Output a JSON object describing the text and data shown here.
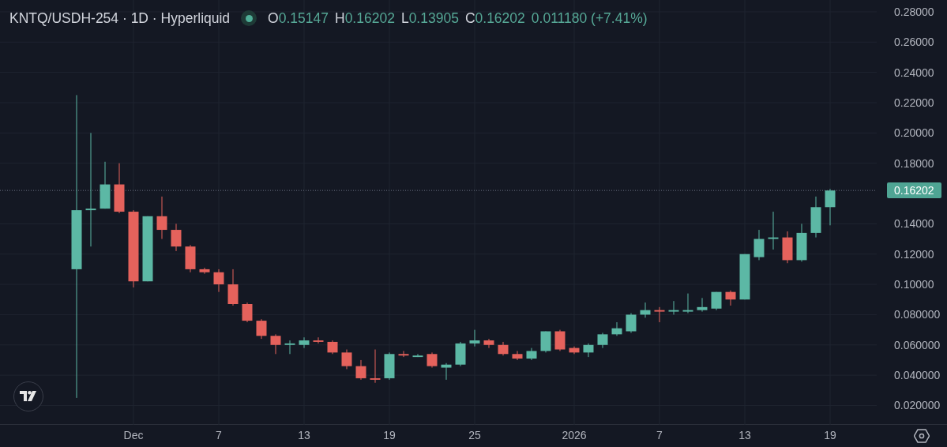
{
  "legend": {
    "symbol": "KNTQ/USDH-254 · 1D · Hyperliquid",
    "ohlc": [
      {
        "key": "O",
        "value": "0.15147"
      },
      {
        "key": "H",
        "value": "0.16202"
      },
      {
        "key": "L",
        "value": "0.13905"
      },
      {
        "key": "C",
        "value": "0.16202"
      }
    ],
    "change": "0.011180 (+7.41%)"
  },
  "chart_data": {
    "type": "candlestick",
    "grid": true,
    "categories": [
      null,
      null,
      null,
      null,
      "Dec",
      null,
      null,
      null,
      null,
      null,
      "7",
      null,
      null,
      null,
      null,
      null,
      "13",
      null,
      null,
      null,
      null,
      null,
      "19",
      null,
      null,
      null,
      null,
      null,
      "25",
      null,
      null,
      null,
      null,
      null,
      null,
      "2026",
      null,
      null,
      null,
      null,
      null,
      "7",
      null,
      null,
      null,
      null,
      null,
      "13",
      null,
      null,
      null,
      null,
      null,
      "19"
    ],
    "ohlc": [
      [
        0.11,
        0.225,
        0.025,
        0.149
      ],
      [
        0.149,
        0.2,
        0.125,
        0.15
      ],
      [
        0.15,
        0.181,
        0.15,
        0.166
      ],
      [
        0.166,
        0.18,
        0.147,
        0.148
      ],
      [
        0.148,
        0.149,
        0.098,
        0.102
      ],
      [
        0.102,
        0.145,
        0.102,
        0.145
      ],
      [
        0.145,
        0.158,
        0.13,
        0.136
      ],
      [
        0.136,
        0.14,
        0.122,
        0.125
      ],
      [
        0.125,
        0.126,
        0.108,
        0.11
      ],
      [
        0.11,
        0.111,
        0.107,
        0.108
      ],
      [
        0.108,
        0.11,
        0.095,
        0.1
      ],
      [
        0.1,
        0.11,
        0.086,
        0.087
      ],
      [
        0.087,
        0.088,
        0.075,
        0.076
      ],
      [
        0.076,
        0.077,
        0.064,
        0.066
      ],
      [
        0.066,
        0.067,
        0.054,
        0.06
      ],
      [
        0.06,
        0.063,
        0.054,
        0.061
      ],
      [
        0.06,
        0.065,
        0.058,
        0.063
      ],
      [
        0.063,
        0.065,
        0.061,
        0.062
      ],
      [
        0.062,
        0.063,
        0.054,
        0.055
      ],
      [
        0.055,
        0.057,
        0.044,
        0.046
      ],
      [
        0.046,
        0.05,
        0.037,
        0.038
      ],
      [
        0.038,
        0.057,
        0.035,
        0.037
      ],
      [
        0.038,
        0.055,
        0.037,
        0.054
      ],
      [
        0.054,
        0.056,
        0.052,
        0.053
      ],
      [
        0.052,
        0.054,
        0.052,
        0.053
      ],
      [
        0.054,
        0.055,
        0.045,
        0.046
      ],
      [
        0.045,
        0.048,
        0.037,
        0.047
      ],
      [
        0.047,
        0.062,
        0.046,
        0.061
      ],
      [
        0.061,
        0.07,
        0.059,
        0.063
      ],
      [
        0.063,
        0.064,
        0.058,
        0.06
      ],
      [
        0.06,
        0.062,
        0.053,
        0.054
      ],
      [
        0.054,
        0.056,
        0.05,
        0.051
      ],
      [
        0.051,
        0.058,
        0.05,
        0.056
      ],
      [
        0.056,
        0.069,
        0.055,
        0.069
      ],
      [
        0.069,
        0.07,
        0.056,
        0.057
      ],
      [
        0.058,
        0.059,
        0.054,
        0.055
      ],
      [
        0.055,
        0.061,
        0.052,
        0.06
      ],
      [
        0.06,
        0.068,
        0.058,
        0.067
      ],
      [
        0.067,
        0.075,
        0.066,
        0.071
      ],
      [
        0.069,
        0.081,
        0.068,
        0.08
      ],
      [
        0.08,
        0.088,
        0.078,
        0.083
      ],
      [
        0.083,
        0.085,
        0.075,
        0.082
      ],
      [
        0.082,
        0.089,
        0.08,
        0.083
      ],
      [
        0.082,
        0.094,
        0.081,
        0.083
      ],
      [
        0.083,
        0.091,
        0.082,
        0.085
      ],
      [
        0.084,
        0.095,
        0.083,
        0.095
      ],
      [
        0.095,
        0.096,
        0.086,
        0.09
      ],
      [
        0.09,
        0.12,
        0.09,
        0.12
      ],
      [
        0.118,
        0.136,
        0.116,
        0.13
      ],
      [
        0.13,
        0.148,
        0.123,
        0.131
      ],
      [
        0.131,
        0.135,
        0.114,
        0.116
      ],
      [
        0.116,
        0.14,
        0.115,
        0.134
      ],
      [
        0.134,
        0.158,
        0.131,
        0.151
      ],
      [
        0.151,
        0.163,
        0.139,
        0.162
      ]
    ],
    "ylim": [
      0.0072,
      0.2878
    ],
    "yticks": [
      {
        "value": 0.28,
        "label": "0.28000"
      },
      {
        "value": 0.26,
        "label": "0.26000"
      },
      {
        "value": 0.24,
        "label": "0.24000"
      },
      {
        "value": 0.22,
        "label": "0.22000"
      },
      {
        "value": 0.2,
        "label": "0.20000"
      },
      {
        "value": 0.18,
        "label": "0.18000"
      },
      {
        "value": 0.14,
        "label": "0.14000"
      },
      {
        "value": 0.12,
        "label": "0.12000"
      },
      {
        "value": 0.1,
        "label": "0.10000"
      },
      {
        "value": 0.08,
        "label": "0.080000"
      },
      {
        "value": 0.06,
        "label": "0.060000"
      },
      {
        "value": 0.04,
        "label": "0.040000"
      },
      {
        "value": 0.02,
        "label": "0.020000"
      }
    ],
    "ref_lines": [
      {
        "axis": "y",
        "value": 0.16202,
        "label": "0.16202"
      }
    ]
  }
}
